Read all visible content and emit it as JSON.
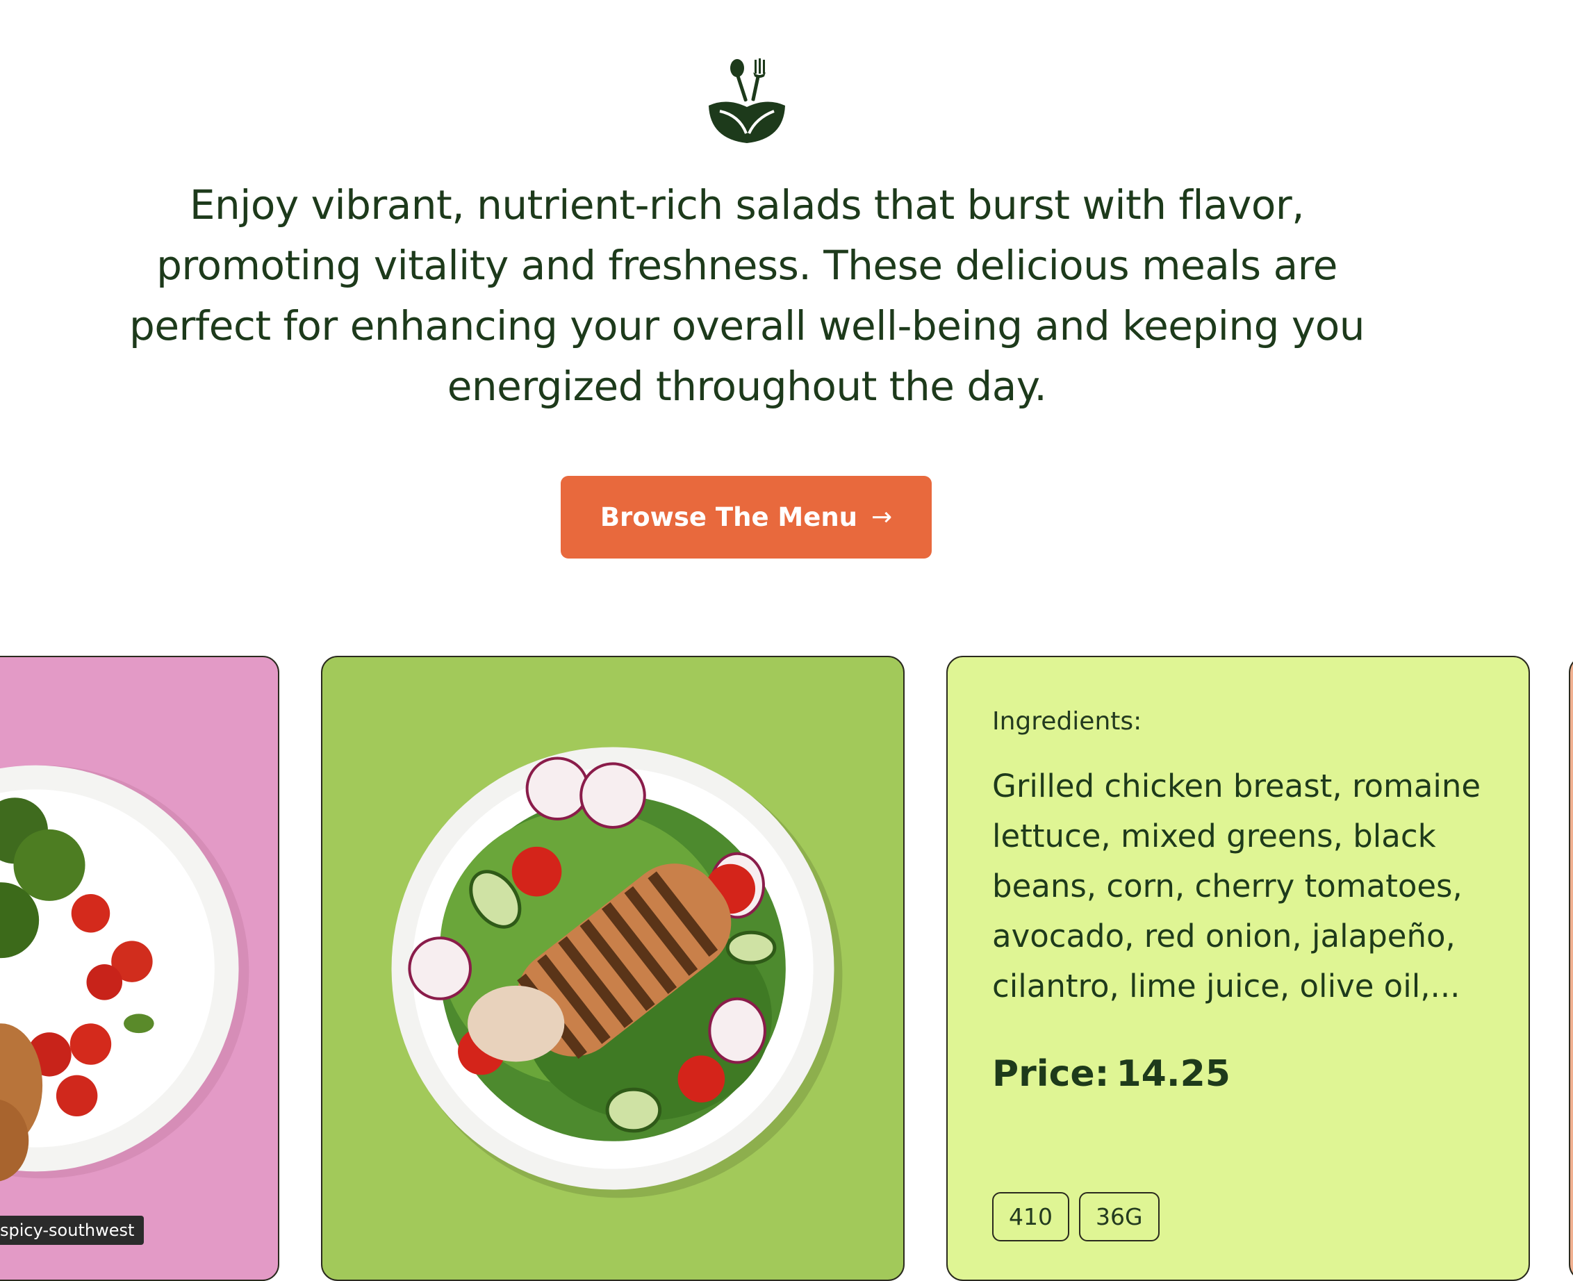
{
  "hero": {
    "logo_icon": "bowl-with-spoon-fork-icon",
    "description": "Enjoy vibrant, nutrient-rich salads that burst with flavor, promoting vitality and freshness. These delicious meals are perfect for enhancing your overall well-being and keeping you energized throughout the day.",
    "cta_label": "Browse The Menu",
    "cta_icon": "arrow-right-icon"
  },
  "cards": [
    {
      "bg": "#e39ac6",
      "image": "plate-broccoli-tomatoes-chicken-image"
    },
    {
      "bg": "#a2c95a",
      "image": "plate-grilled-chicken-salad-image"
    },
    {
      "bg": "#dff594",
      "ingredients_label": "Ingredients:",
      "ingredients": "Grilled chicken breast, romaine lettuce, mixed greens, black beans, corn, cherry tomatoes, avocado, red onion, jalapeño, cilantro, lime juice, olive oil,...",
      "price_label": "Price:",
      "price_value": "14.25",
      "chips": [
        "410",
        "36G"
      ]
    }
  ],
  "tooltip": "spicy-southwest",
  "colors": {
    "accent": "#e8693d",
    "text": "#1d3a1b"
  }
}
